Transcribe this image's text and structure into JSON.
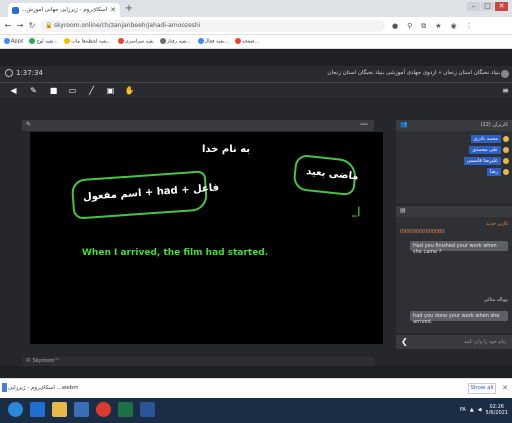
{
  "browser": {
    "tab_title": "اسکای‌روم - ژیرزایی جهانی آموزش...",
    "url": "skyroom.online/ch/zanjanbeeh/jahadi-amoozeshi",
    "bookmarks": [
      "Apps",
      "بقیه لوح...",
      "بقیه لحظه‌ها مات...",
      "بقیه سراسری",
      "بقیه رفتار...",
      "بقیه فعال...",
      "صفحه..."
    ]
  },
  "app": {
    "timer": "1:37:34",
    "room_title": "بنیاد نخبگان استان زنجان » اردوی جهادی آموزشی بنیاد نخبگان استان زنجان"
  },
  "whiteboard": {
    "header_label": "تخته",
    "bismillah": "به نام خدا",
    "box_left": "اسم مفعول + had + فاعل",
    "box_right": "ماضی بعید",
    "sentence": "When I arrived, the film had started.",
    "mark": "_|",
    "footer": "© Skyroom™"
  },
  "participants": {
    "header": "کاربران (22)",
    "users": [
      "محمد نادری",
      "علی محمدی",
      "علیرضا قاسمی",
      "رضا"
    ]
  },
  "chat": {
    "sender1": "کاربر جدید",
    "phone": "09009000000080",
    "msg1": "Had you finished your work when she came ?",
    "sender2": "پوپاله مثالی",
    "msg2": "had you done your work when she arrived.",
    "input_placeholder": "پیام خود را وارد کنید"
  },
  "downloads": {
    "file_name": "اسکای‌روم - ژیرزایی ...webm",
    "show_all": "Show all"
  },
  "taskbar": {
    "lang": "FA",
    "time": "02:26",
    "date": "5/6/2021"
  },
  "colors": {
    "accent_green": "#47c443",
    "user_blue": "#2f5fc4",
    "chat_meta": "#e08a50"
  }
}
